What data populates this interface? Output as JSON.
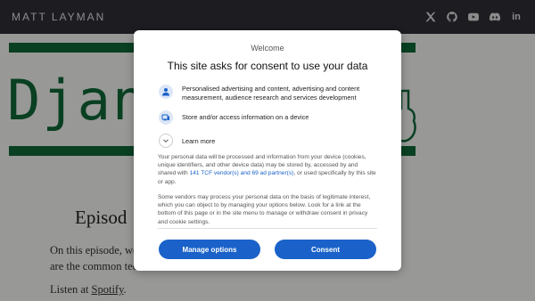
{
  "site": {
    "title": "MATT LAYMAN",
    "social_icons": [
      "x-icon",
      "github-icon",
      "youtube-icon",
      "discord-icon",
      "linkedin-icon"
    ],
    "linkedin_text": "in",
    "banner_word": "Djang",
    "episode_title": "Episod",
    "episode_body": "On this episode, w                                                                                         are the common tech",
    "episode_body_line1": "On this episode, we",
    "episode_body_line2": "are the common tec",
    "listen_prefix": "Listen at ",
    "listen_link": "Spotify",
    "listen_suffix": ".",
    "accent_color": "#0f6b3a"
  },
  "consent": {
    "welcome": "Welcome",
    "headline": "This site asks for consent to use your data",
    "purposes": [
      {
        "icon": "person-icon",
        "text": "Personalised advertising and content, advertising and content measurement, audience research and services development"
      },
      {
        "icon": "device-icon",
        "text": "Store and/or access information on a device"
      }
    ],
    "learn_more": "Learn more",
    "para1_a": "Your personal data will be processed and information from your device (cookies, unique identifiers, and other device data) may be stored by, accessed by and shared with ",
    "para1_link": "141 TCF vendor(s) and 69 ad partner(s)",
    "para1_b": ", or used specifically by this site or app.",
    "para2": "Some vendors may process your personal data on the basis of legitimate interest, which you can object to by managing your options below. Look for a link at the bottom of this page or in the site menu to manage or withdraw consent in privacy and cookie settings.",
    "manage_button": "Manage options",
    "consent_button": "Consent",
    "button_color": "#1a62c9"
  }
}
